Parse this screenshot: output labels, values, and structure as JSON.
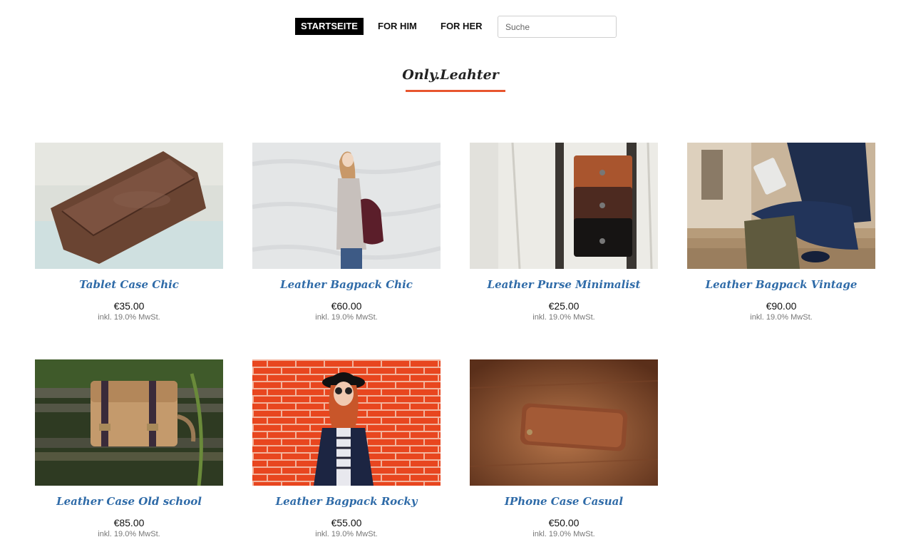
{
  "nav": {
    "home_label": "STARTSEITE",
    "him_label": "FOR HIM",
    "her_label": "FOR HER",
    "search_placeholder": "Suche"
  },
  "brand": {
    "name": "Only.Leahter"
  },
  "colors": {
    "accent": "#e8552e",
    "link": "#2f6ba8",
    "nav_active_bg": "#000000"
  },
  "products": [
    {
      "title": "Tablet Case Chic",
      "price": "€35.00",
      "tax": "inkl. 19.0% MwSt."
    },
    {
      "title": "Leather Bagpack Chic",
      "price": "€60.00",
      "tax": "inkl. 19.0% MwSt."
    },
    {
      "title": "Leather Purse Minimalist",
      "price": "€25.00",
      "tax": "inkl. 19.0% MwSt."
    },
    {
      "title": "Leather Bagpack Vintage",
      "price": "€90.00",
      "tax": "inkl. 19.0% MwSt."
    },
    {
      "title": "Leather Case Old school",
      "price": "€85.00",
      "tax": "inkl. 19.0% MwSt."
    },
    {
      "title": "Leather Bagpack Rocky",
      "price": "€55.00",
      "tax": "inkl. 19.0% MwSt."
    },
    {
      "title": "IPhone Case Casual",
      "price": "€50.00",
      "tax": "inkl. 19.0% MwSt."
    }
  ]
}
